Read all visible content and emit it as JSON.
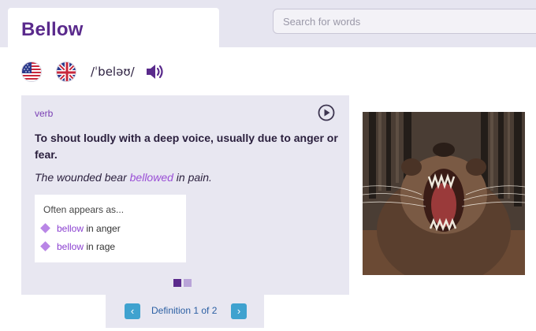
{
  "word": {
    "title": "Bellow"
  },
  "search": {
    "placeholder": "Search for words"
  },
  "pronunciation": {
    "ipa": "/ˈbeləʊ/",
    "flags": [
      "us-flag-icon",
      "uk-flag-icon"
    ],
    "speaker_icon": "speaker-icon"
  },
  "definition": {
    "part_of_speech": "verb",
    "text": "To shout loudly with a deep voice, usually due to anger or fear.",
    "example_before": "The wounded bear ",
    "example_highlight": "bellowed",
    "example_after": " in pain.",
    "play_icon": "play-circle-icon",
    "appears_heading": "Often appears as...",
    "collocations": [
      {
        "keyword": "bellow",
        "rest": " in anger"
      },
      {
        "keyword": "bellow",
        "rest": " in rage"
      }
    ],
    "page_dots": {
      "total": 2,
      "active": 1
    }
  },
  "pager": {
    "label": "Definition 1 of 2",
    "prev_icon": "chevron-left-icon",
    "next_icon": "chevron-right-icon"
  },
  "image": {
    "subject": "roaring-bear-image"
  },
  "colors": {
    "brand_purple": "#5a2a8c",
    "highlight_purple": "#9a4fd6",
    "pager_blue": "#3fa2cf",
    "card_bg": "#e8e7f1"
  }
}
